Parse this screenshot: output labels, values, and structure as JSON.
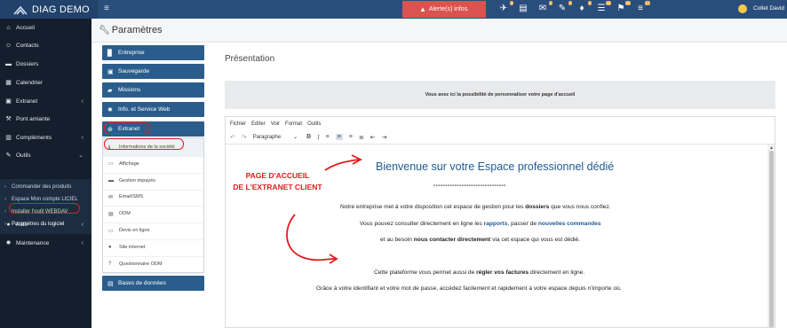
{
  "app": {
    "title": "DIAG DEMO"
  },
  "topbar": {
    "alert_label": "Alerte(s) infos.",
    "icons": [
      {
        "name": "paper-plane-icon",
        "glyph": "✈",
        "badge": "3"
      },
      {
        "name": "inbox-icon",
        "glyph": "▤",
        "badge": ""
      },
      {
        "name": "mail-check-icon",
        "glyph": "✉",
        "badge": "4"
      },
      {
        "name": "pin-icon",
        "glyph": "✎",
        "badge": "2"
      },
      {
        "name": "bell-icon",
        "glyph": "♦",
        "badge": "8"
      },
      {
        "name": "list-icon",
        "glyph": "☰",
        "badge": "18"
      },
      {
        "name": "flag-icon",
        "glyph": "⚑",
        "badge": "25"
      },
      {
        "name": "tasks-icon",
        "glyph": "≡",
        "badge": "17"
      }
    ],
    "user": "Collet David"
  },
  "sidebar": {
    "items": [
      {
        "label": "Accueil",
        "glyph": "⌂",
        "chev": ""
      },
      {
        "label": "Contacts",
        "glyph": "☺",
        "chev": ""
      },
      {
        "label": "Dossiers",
        "glyph": "▬",
        "chev": ""
      },
      {
        "label": "Calendrier",
        "glyph": "▦",
        "chev": ""
      },
      {
        "label": "Extranet",
        "glyph": "▣",
        "chev": "‹"
      },
      {
        "label": "Pont amiante",
        "glyph": "⚒",
        "chev": ""
      },
      {
        "label": "Compléments",
        "glyph": "▥",
        "chev": "‹"
      },
      {
        "label": "Outils",
        "glyph": "✎",
        "chev": "⌄"
      }
    ],
    "outils_sub": [
      "Commander des produits",
      "Espace Mon compte LICIEL",
      "Installer l'outil WEBDAV",
      "Paramètres du logiciel"
    ],
    "bottom": [
      {
        "label": "Aide",
        "glyph": "●",
        "chev": "‹"
      },
      {
        "label": "Maintenance",
        "glyph": "✹",
        "chev": "‹"
      }
    ]
  },
  "page": {
    "title": "Paramètres"
  },
  "settings_menu": {
    "top": [
      {
        "label": "Entreprise",
        "glyph": "▉"
      },
      {
        "label": "Sauvegarde",
        "glyph": "▣"
      },
      {
        "label": "Missions",
        "glyph": "▰"
      },
      {
        "label": "Info. et Service Web",
        "glyph": "✹"
      },
      {
        "label": "Extranet",
        "glyph": "⊛"
      }
    ],
    "extranet_items": [
      {
        "label": "Informations de la société",
        "glyph": "ℹ"
      },
      {
        "label": "Affichage",
        "glyph": "▭"
      },
      {
        "label": "Gestion impayés",
        "glyph": "▬"
      },
      {
        "label": "Email/SMS",
        "glyph": "✉"
      },
      {
        "label": "ODM",
        "glyph": "▤"
      },
      {
        "label": "Devis en ligne",
        "glyph": "▭"
      },
      {
        "label": "Site internet",
        "glyph": "●"
      },
      {
        "label": "Questionnaire ODM",
        "glyph": "?"
      }
    ],
    "bottom": {
      "label": "Bases de données",
      "glyph": "▤"
    }
  },
  "content": {
    "heading": "Présentation",
    "info": "Vous avez ici la possibilité de personnaliser votre page d'accueil",
    "editor": {
      "menus": [
        "Fichier",
        "Editer",
        "Voir",
        "Format",
        "Outils"
      ],
      "format_select": "Paragraphe",
      "welcome": "Bienvenue sur votre Espace professionnel dédié",
      "dashes": "-------------------------------",
      "p1": {
        "a": "Notre entreprise met à votre disposition cet espace de gestion pour les ",
        "b": "dossiers",
        "c": " que vous nous confiez."
      },
      "p2": {
        "a": "Vous pouvez consulter directement en ligne les ",
        "b": "rapports",
        "c": ", passer de ",
        "d": "nouvelles commandes"
      },
      "p3": {
        "a": "et au besoin ",
        "b": "nous contacter directement",
        "c": " via cet espace qui vous est dédié."
      },
      "p4": {
        "a": "Cette plateforme vous permet aussi de ",
        "b": "régler vos factures",
        "c": " directement en ligne."
      },
      "p5": "Grâce à votre identifiant et votre mot de passe, accédez facilement et rapidement à votre espace depuis n'importe où."
    },
    "annotation": {
      "line1": "PAGE D'ACCUEIL",
      "line2": "DE L'EXTRANET CLIENT"
    }
  },
  "colors": {
    "topbar": "#2a4e7c",
    "sidebar": "#141e2c",
    "menu_button": "#2a5d8c",
    "alert": "#d9534f",
    "annotation": "#e31a1c",
    "welcome": "#1f5a92"
  }
}
